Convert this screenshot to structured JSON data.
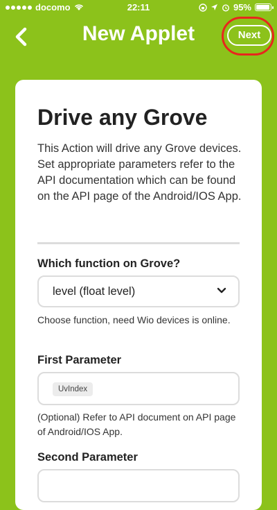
{
  "status_bar": {
    "carrier": "docomo",
    "time": "22:11",
    "battery": "95%"
  },
  "nav": {
    "title": "New Applet",
    "next_label": "Next"
  },
  "card": {
    "title": "Drive any Grove",
    "description": "This Action will drive any Grove devices. Set appropriate parameters refer to the API documentation which can be found on the API page of the Android/IOS App.",
    "fields": [
      {
        "label": "Which function on Grove?",
        "type": "select",
        "value": "level (float level)",
        "hint": "Choose function, need Wio devices is online."
      },
      {
        "label": "First Parameter",
        "type": "text",
        "chip": "UvIndex",
        "hint": "(Optional) Refer to API document on API page of Android/IOS App."
      },
      {
        "label": "Second Parameter",
        "type": "text",
        "value": ""
      }
    ]
  },
  "colors": {
    "background": "#8cc21b",
    "highlight": "#e8261d"
  }
}
